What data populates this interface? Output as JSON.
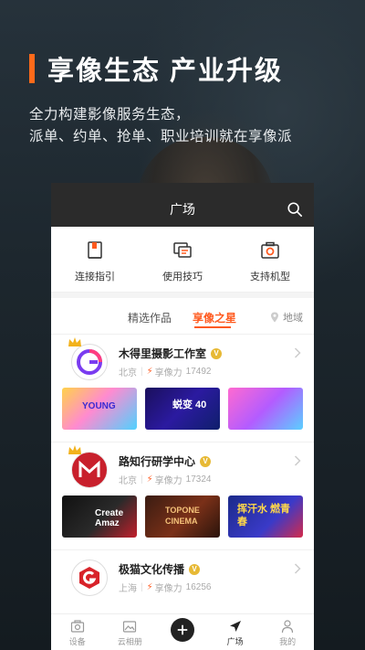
{
  "promo": {
    "title": "享像生态 产业升级",
    "line1": "全力构建影像服务生态，",
    "line2": "派单、约单、抢单、职业培训就在享像派"
  },
  "app": {
    "header_title": "广场",
    "quick_actions": [
      {
        "label": "连接指引",
        "icon": "book-icon"
      },
      {
        "label": "使用技巧",
        "icon": "chat-tips-icon"
      },
      {
        "label": "支持机型",
        "icon": "camera-icon"
      }
    ],
    "tabs": {
      "works": "精选作品",
      "stars": "享像之星",
      "region": "地域"
    },
    "studios": [
      {
        "name": "木得里摄影工作室",
        "badge": "V",
        "city": "北京",
        "power_label": "享像力",
        "power": "17492",
        "thumbs": [
          "YOUNG",
          "蜕变 40",
          ""
        ]
      },
      {
        "name": "路知行研学中心",
        "badge": "V",
        "city": "北京",
        "power_label": "享像力",
        "power": "17324",
        "thumbs": [
          "Create Amaz",
          "TOPONE CINEMA",
          "挥汗水 燃青春"
        ]
      },
      {
        "name": "极猫文化传播",
        "badge": "V",
        "city": "上海",
        "power_label": "享像力",
        "power": "16256",
        "thumbs": []
      }
    ],
    "bottom_nav": [
      {
        "label": "设备",
        "icon": "camera-icon"
      },
      {
        "label": "云相册",
        "icon": "cloud-album-icon"
      },
      {
        "label": "",
        "icon": "plus-icon"
      },
      {
        "label": "广场",
        "icon": "compass-icon"
      },
      {
        "label": "我的",
        "icon": "user-icon"
      }
    ],
    "colors": {
      "accent": "#ff5a1f",
      "badge": "#e7b935",
      "header": "#2b2b2b"
    }
  }
}
